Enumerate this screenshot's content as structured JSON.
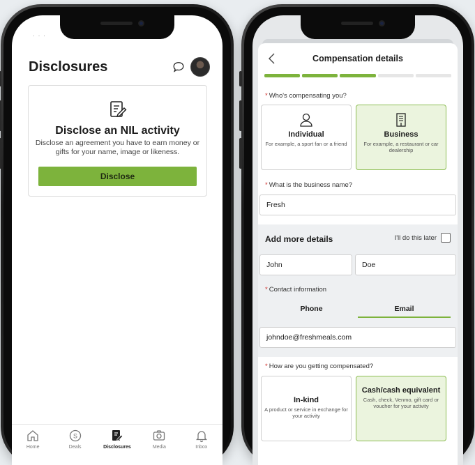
{
  "left": {
    "status_text": "· · ·",
    "title": "Disclosures",
    "card": {
      "title": "Disclose an NIL activity",
      "description": "Disclose an agreement you have to earn money or gifts for your name, image or likeness.",
      "button": "Disclose"
    },
    "tabs": [
      {
        "label": "Home",
        "icon": "home-icon"
      },
      {
        "label": "Deals",
        "icon": "deals-icon"
      },
      {
        "label": "Disclosures",
        "icon": "disclosures-icon",
        "active": true
      },
      {
        "label": "Media",
        "icon": "camera-icon"
      },
      {
        "label": "Inbox",
        "icon": "bell-icon"
      }
    ]
  },
  "right": {
    "title": "Compensation details",
    "progress": {
      "completed": 3,
      "total": 5
    },
    "q1": {
      "label": "Who's compensating you?"
    },
    "choices1": [
      {
        "title": "Individual",
        "sub": "For example, a sport fan or a friend",
        "icon": "person-icon",
        "selected": false
      },
      {
        "title": "Business",
        "sub": "For example, a restaurant or car dealership",
        "icon": "building-icon",
        "selected": true
      }
    ],
    "q2": {
      "label": "What is the business name?"
    },
    "business_name": "Fresh",
    "add_more": {
      "title": "Add more details",
      "later_label": "I'll do this later"
    },
    "first_name": "John",
    "last_name": "Doe",
    "q3": {
      "label": "Contact information"
    },
    "contact_tabs": [
      {
        "label": "Phone",
        "active": false
      },
      {
        "label": "Email",
        "active": true
      }
    ],
    "email": "johndoe@freshmeals.com",
    "q4": {
      "label": "How are you getting compensated?"
    },
    "choices2": [
      {
        "title": "In-kind",
        "sub": "A product or service in exchange for your activity",
        "selected": false
      },
      {
        "title": "Cash/cash equivalent",
        "sub": "Cash, check, Venmo, gift card or voucher for your activity",
        "selected": true
      }
    ],
    "accent": "#7db33c"
  }
}
